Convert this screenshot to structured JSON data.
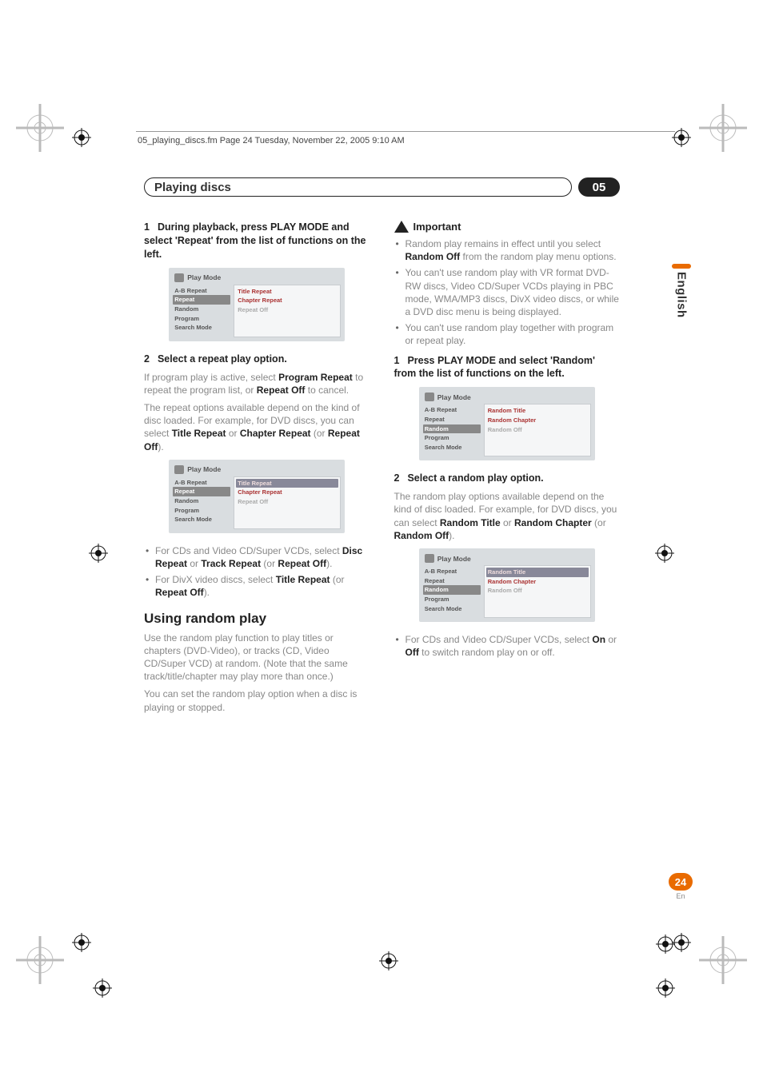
{
  "header_line": "05_playing_discs.fm  Page 24  Tuesday, November 22, 2005  9:10 AM",
  "title": "Playing discs",
  "chapter_number": "05",
  "side": {
    "language": "English"
  },
  "pagenum": {
    "num": "24",
    "code": "En"
  },
  "left": {
    "step1": "During playback, press PLAY MODE and select 'Repeat' from the list of functions on the left.",
    "step2_heading": "Select a repeat play option.",
    "step2_p1a": "If program play is active, select ",
    "step2_p1b": "Program Repeat",
    "step2_p1c": " to repeat the program list, or ",
    "step2_p1d": "Repeat Off",
    "step2_p1e": " to cancel.",
    "step2_p2a": "The repeat options available depend on the kind of disc loaded. For example, for DVD discs, you can select ",
    "step2_p2b": "Title Repeat",
    "step2_p2c": " or ",
    "step2_p2d": "Chapter Repeat",
    "step2_p2e": " (or ",
    "step2_p2f": "Repeat Off",
    "step2_p2g": ").",
    "bullet1a": "For CDs and Video CD/Super VCDs, select ",
    "bullet1b": "Disc Repeat",
    "bullet1c": " or ",
    "bullet1d": "Track Repeat",
    "bullet1e": " (or ",
    "bullet1f": "Repeat Off",
    "bullet1g": ").",
    "bullet2a": "For DivX video discs, select ",
    "bullet2b": "Title Repeat",
    "bullet2c": " (or ",
    "bullet2d": "Repeat Off",
    "bullet2e": ").",
    "h2": "Using random play",
    "rp1": "Use the random play function to play titles or chapters (DVD-Video), or tracks (CD, Video CD/Super VCD) at random. (Note that the same track/title/chapter may play more than once.)",
    "rp2": "You can set the random play option when a disc is playing or stopped."
  },
  "right": {
    "important": "Important",
    "imp_b1a": "Random play remains in effect until you select ",
    "imp_b1b": "Random Off",
    "imp_b1c": " from the random play menu options.",
    "imp_b2": "You can't use random play with VR format DVD-RW discs, Video CD/Super VCDs playing in PBC mode, WMA/MP3 discs, DivX video discs, or while a DVD disc menu is being displayed.",
    "imp_b3": "You can't use random play together with program or repeat play.",
    "step1": "Press PLAY MODE and select 'Random' from the list of functions on the left.",
    "step2_heading": "Select a random play option.",
    "step2_p1a": "The random play options available depend on the kind of disc loaded. For example, for DVD discs, you can select ",
    "step2_p1b": "Random Title",
    "step2_p1c": " or ",
    "step2_p1d": "Random Chapter",
    "step2_p1e": " (or ",
    "step2_p1f": "Random Off",
    "step2_p1g": ").",
    "bullet1a": "For CDs and Video CD/Super VCDs, select ",
    "bullet1b": "On",
    "bullet1c": " or ",
    "bullet1d": "Off",
    "bullet1e": " to switch random play on or off."
  },
  "menus": {
    "title": "Play Mode",
    "left_items": [
      "A-B Repeat",
      "Repeat",
      "Random",
      "Program",
      "Search Mode"
    ],
    "repeat_right": [
      "Title Repeat",
      "Chapter Repeat",
      "Repeat Off"
    ],
    "random_right": [
      "Random Title",
      "Random Chapter",
      "Random Off"
    ]
  }
}
